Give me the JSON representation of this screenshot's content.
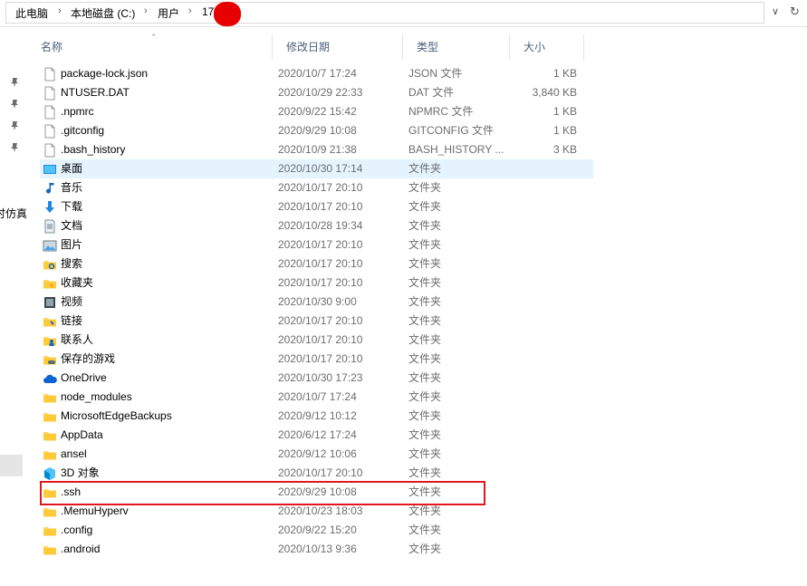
{
  "breadcrumb": {
    "items": [
      "此电脑",
      "本地磁盘 (C:)",
      "用户",
      "17"
    ]
  },
  "nav": {
    "partial_label": "时仿真"
  },
  "columns": {
    "name": "名称",
    "date": "修改日期",
    "type": "类型",
    "size": "大小"
  },
  "files": [
    {
      "name": "package-lock.json",
      "date": "2020/10/7 17:24",
      "type": "JSON 文件",
      "size": "1 KB",
      "icon": "file-icon"
    },
    {
      "name": "NTUSER.DAT",
      "date": "2020/10/29 22:33",
      "type": "DAT 文件",
      "size": "3,840 KB",
      "icon": "file-icon"
    },
    {
      "name": ".npmrc",
      "date": "2020/9/22 15:42",
      "type": "NPMRC 文件",
      "size": "1 KB",
      "icon": "file-icon"
    },
    {
      "name": ".gitconfig",
      "date": "2020/9/29 10:08",
      "type": "GITCONFIG 文件",
      "size": "1 KB",
      "icon": "file-icon"
    },
    {
      "name": ".bash_history",
      "date": "2020/10/9 21:38",
      "type": "BASH_HISTORY ...",
      "size": "3 KB",
      "icon": "file-icon"
    },
    {
      "name": "桌面",
      "date": "2020/10/30 17:14",
      "type": "文件夹",
      "size": "",
      "icon": "desktop-folder-icon"
    },
    {
      "name": "音乐",
      "date": "2020/10/17 20:10",
      "type": "文件夹",
      "size": "",
      "icon": "music-folder-icon"
    },
    {
      "name": "下载",
      "date": "2020/10/17 20:10",
      "type": "文件夹",
      "size": "",
      "icon": "downloads-folder-icon"
    },
    {
      "name": "文档",
      "date": "2020/10/28 19:34",
      "type": "文件夹",
      "size": "",
      "icon": "documents-folder-icon"
    },
    {
      "name": "图片",
      "date": "2020/10/17 20:10",
      "type": "文件夹",
      "size": "",
      "icon": "pictures-folder-icon"
    },
    {
      "name": "搜索",
      "date": "2020/10/17 20:10",
      "type": "文件夹",
      "size": "",
      "icon": "searches-folder-icon"
    },
    {
      "name": "收藏夹",
      "date": "2020/10/17 20:10",
      "type": "文件夹",
      "size": "",
      "icon": "favorites-folder-icon"
    },
    {
      "name": "视频",
      "date": "2020/10/30 9:00",
      "type": "文件夹",
      "size": "",
      "icon": "videos-folder-icon"
    },
    {
      "name": "链接",
      "date": "2020/10/17 20:10",
      "type": "文件夹",
      "size": "",
      "icon": "links-folder-icon"
    },
    {
      "name": "联系人",
      "date": "2020/10/17 20:10",
      "type": "文件夹",
      "size": "",
      "icon": "contacts-folder-icon"
    },
    {
      "name": "保存的游戏",
      "date": "2020/10/17 20:10",
      "type": "文件夹",
      "size": "",
      "icon": "saved-games-folder-icon"
    },
    {
      "name": "OneDrive",
      "date": "2020/10/30 17:23",
      "type": "文件夹",
      "size": "",
      "icon": "onedrive-icon"
    },
    {
      "name": "node_modules",
      "date": "2020/10/7 17:24",
      "type": "文件夹",
      "size": "",
      "icon": "folder-icon"
    },
    {
      "name": "MicrosoftEdgeBackups",
      "date": "2020/9/12 10:12",
      "type": "文件夹",
      "size": "",
      "icon": "folder-icon"
    },
    {
      "name": "AppData",
      "date": "2020/6/12 17:24",
      "type": "文件夹",
      "size": "",
      "icon": "folder-icon"
    },
    {
      "name": "ansel",
      "date": "2020/9/12 10:06",
      "type": "文件夹",
      "size": "",
      "icon": "folder-icon"
    },
    {
      "name": "3D 对象",
      "date": "2020/10/17 20:10",
      "type": "文件夹",
      "size": "",
      "icon": "3d-objects-folder-icon"
    },
    {
      "name": ".ssh",
      "date": "2020/9/29 10:08",
      "type": "文件夹",
      "size": "",
      "icon": "folder-icon"
    },
    {
      "name": ".MemuHyperv",
      "date": "2020/10/23 18:03",
      "type": "文件夹",
      "size": "",
      "icon": "folder-icon"
    },
    {
      "name": ".config",
      "date": "2020/9/22 15:20",
      "type": "文件夹",
      "size": "",
      "icon": "folder-icon"
    },
    {
      "name": ".android",
      "date": "2020/10/13 9:36",
      "type": "文件夹",
      "size": "",
      "icon": "folder-icon"
    }
  ],
  "selected_index": 5,
  "highlighted_name": ".ssh",
  "colors": {
    "selection": "#e5f3ff",
    "highlight_border": "#e0181d",
    "folder": "#ffd767",
    "header_text": "#4c607a"
  }
}
